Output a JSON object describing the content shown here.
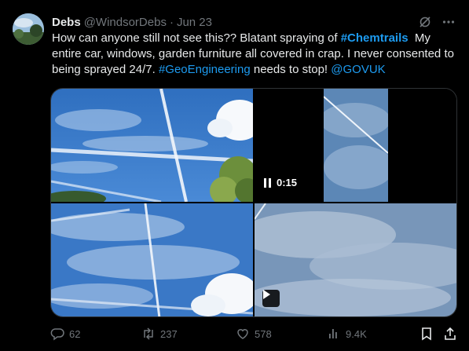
{
  "author": {
    "name": "Debs",
    "handle": "@WindsorDebs",
    "separator": "·",
    "date": "Jun 23"
  },
  "tweet": {
    "text_part1": "How can anyone still not see this?? Blatant spraying of ",
    "hashtag1": "#Chemtrails",
    "text_part2": "  My entire car, windows, garden furniture all covered in crap. I never consented to being sprayed 24/7. ",
    "hashtag2": "#GeoEngineering",
    "text_part3": " needs to stop! ",
    "mention": "@GOVUK"
  },
  "media": {
    "video_duration": "0:15"
  },
  "actions": {
    "replies": "62",
    "reposts": "237",
    "likes": "578",
    "views": "9.4K"
  },
  "icons": {
    "top": [
      "grok-icon",
      "more-icon"
    ],
    "actions": [
      "reply-icon",
      "repost-icon",
      "like-icon",
      "views-icon",
      "bookmark-icon",
      "share-icon"
    ]
  },
  "colors": {
    "accent": "#1d9bf0",
    "muted": "#71767b",
    "text": "#e7e9ea",
    "background": "#000000"
  }
}
